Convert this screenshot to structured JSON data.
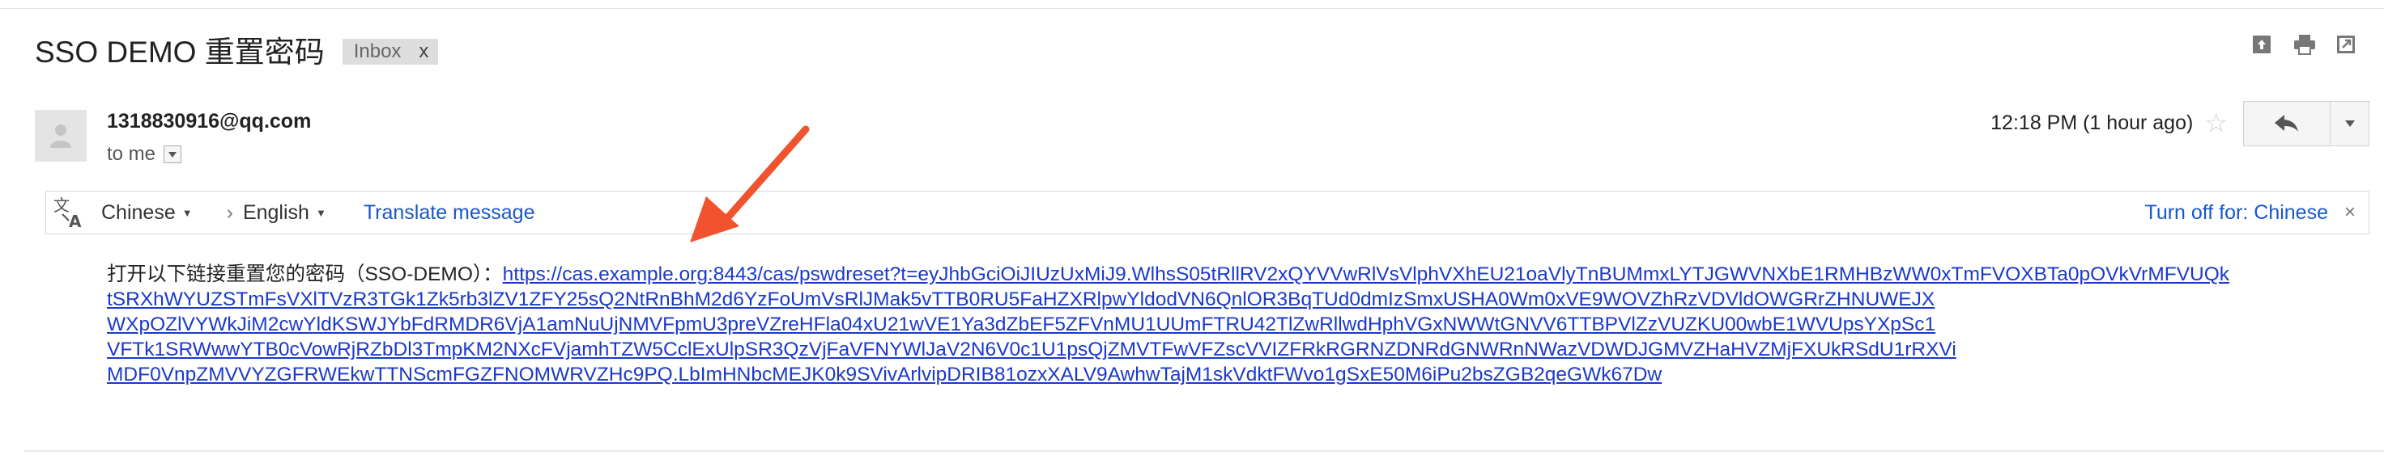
{
  "email": {
    "subject": "SSO DEMO 重置密码",
    "label": "Inbox",
    "label_remove": "x",
    "sender": "1318830916@qq.com",
    "recipient": "to me",
    "timestamp": "12:18 PM (1 hour ago)",
    "body_intro": "打开以下链接重置您的密码（SSO-DEMO）：",
    "link_lines": [
      "https://cas.example.org:8443/cas/pswdreset?t=eyJhbGciOiJIUzUxMiJ9.WlhsS05tRllRV2xQYVVwRlVsVlphVXhEU21oaVlyTnBUMmxLYTJGWVNXbE1RMHBzWW0xTmFVOXBTa0pOVkVrMFVUQk",
      "tSRXhWYUZSTmFsVXlTVzR3TGk1Zk5rb3lZV1ZFY25sQ2NtRnBhM2d6YzFoUmVsRlJMak5vTTB0RU5FaHZXRlpwYldodVN6QnlOR3BqTUd0dmIzSmxUSHA0Wm0xVE9WOVZhRzVDVldOWGRrZHNUWEJX",
      "WXpOZlVYWkJiM2cwYldKSWJYbFdRMDR6VjA1amNuUjNMVFpmU3preVZreHFla04xU21wVE1Ya3dZbEF5ZFVnMU1UUmFTRU42TlZwRllwdHphVGxNWWtGNVV6TTBPVlZzVUZKU00wbE1WVUpsYXpSc1",
      "VFTk1SRWwwYTB0cVowRjRZbDl3TmpKM2NXcFVjamhTZW5CclExUlpSR3QzVjFaVFNYWlJaV2N6V0c1U1psQjZMVTFwVFZscVVIZFRkRGRNZDNRdGNWRnNWazVDWDJGMVZHaHVZMjFXUkRSdU1rRXVi",
      "MDF0VnpZMVVYZGFRWEkwTTNScmFGZFNOMWRVZHc9PQ.LbImHNbcMEJK0k9SVivArlvipDRIB81ozxXALV9AwhwTajM1skVdktFWvo1gSxE50M6iPu2bsZGB2qeGWk67Dw"
    ]
  },
  "translate": {
    "source_lang": "Chinese",
    "target_lang": "English",
    "action": "Translate message",
    "turn_off": "Turn off for: Chinese",
    "close": "×"
  },
  "icons": {
    "archive": "archive-icon",
    "print": "print-icon",
    "new_window": "new-window-icon",
    "reply": "reply-icon",
    "more": "more-options-icon",
    "star": "star-icon",
    "translate": "translate-icon",
    "avatar": "avatar-icon"
  },
  "colors": {
    "link": "#1a39cc",
    "translate_link": "#1a57cb",
    "chip_bg": "#dddddd",
    "annotation_arrow": "#f0532e"
  }
}
